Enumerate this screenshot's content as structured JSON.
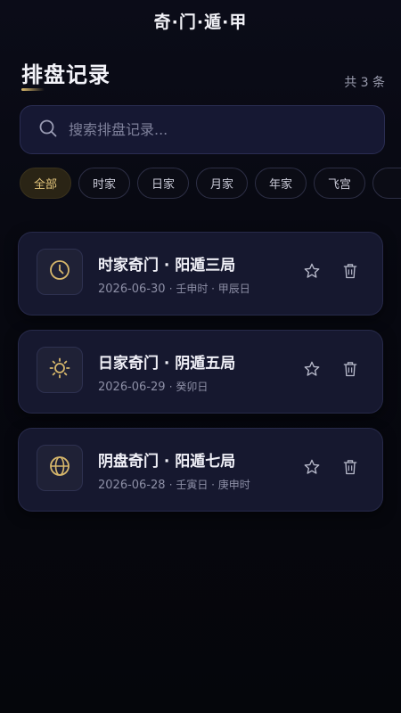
{
  "app": {
    "title": "奇·门·遁·甲"
  },
  "header": {
    "title": "排盘记录",
    "count_text": "共 3 条"
  },
  "search": {
    "placeholder": "搜索排盘记录..."
  },
  "filters": [
    {
      "label": "全部",
      "active": true
    },
    {
      "label": "时家",
      "active": false
    },
    {
      "label": "日家",
      "active": false
    },
    {
      "label": "月家",
      "active": false
    },
    {
      "label": "年家",
      "active": false
    },
    {
      "label": "飞宫",
      "active": false
    }
  ],
  "records": [
    {
      "icon": "clock-icon",
      "title": "时家奇门 · 阳遁三局",
      "date": "2026-06-30",
      "details": "· 壬申时 · 甲辰日"
    },
    {
      "icon": "sun-icon",
      "title": "日家奇门 · 阴遁五局",
      "date": "2026-06-29",
      "details": "· 癸卯日"
    },
    {
      "icon": "globe-icon",
      "title": "阴盘奇门 · 阳遁七局",
      "date": "2026-06-28",
      "details": "· 壬寅日 · 庚申时"
    }
  ],
  "colors": {
    "accent": "#d7b76b",
    "card_bg": "#16182f",
    "page_bg": "#07080f"
  }
}
